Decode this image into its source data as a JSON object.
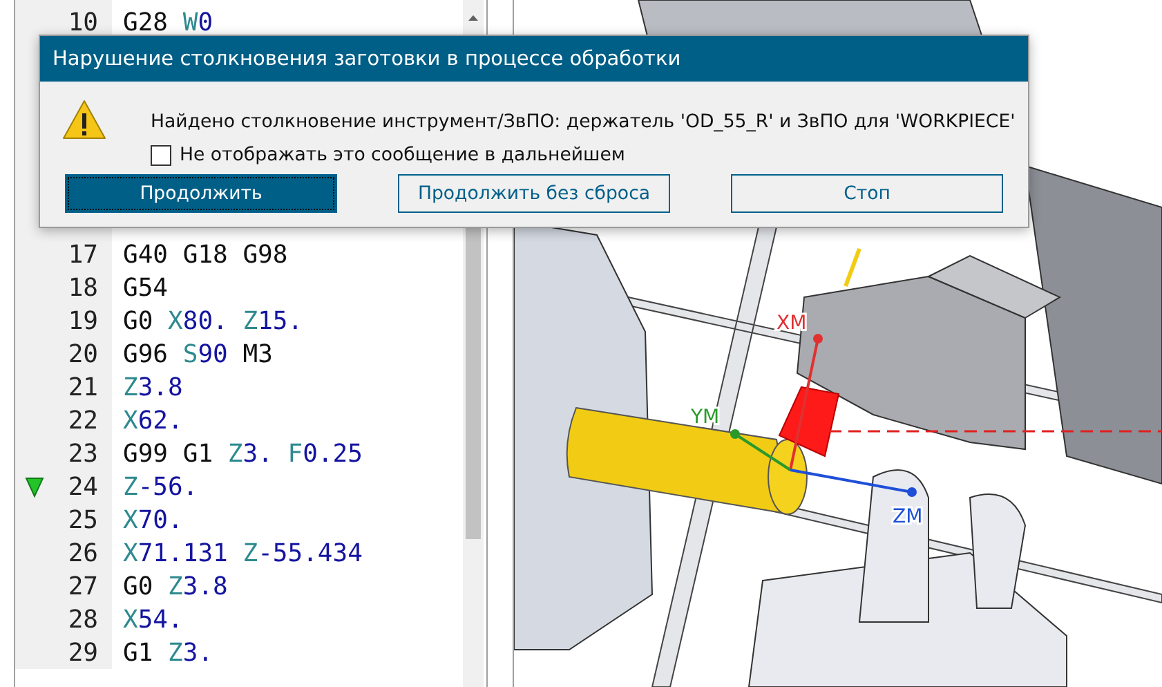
{
  "editor": {
    "lines": [
      {
        "number": "10",
        "marker": false,
        "tokens": [
          {
            "kind": "word",
            "text": "G28"
          },
          {
            "kind": "address",
            "letter": "W",
            "value": "0"
          }
        ]
      },
      {
        "number": "17",
        "marker": false,
        "tokens": [
          {
            "kind": "word",
            "text": "G40"
          },
          {
            "kind": "word",
            "text": "G18"
          },
          {
            "kind": "word",
            "text": "G98"
          }
        ]
      },
      {
        "number": "18",
        "marker": false,
        "tokens": [
          {
            "kind": "word",
            "text": "G54"
          }
        ]
      },
      {
        "number": "19",
        "marker": false,
        "tokens": [
          {
            "kind": "word",
            "text": "G0"
          },
          {
            "kind": "address",
            "letter": "X",
            "value": "80."
          },
          {
            "kind": "address",
            "letter": "Z",
            "value": "15."
          }
        ]
      },
      {
        "number": "20",
        "marker": false,
        "tokens": [
          {
            "kind": "word",
            "text": "G96"
          },
          {
            "kind": "address",
            "letter": "S",
            "value": "90"
          },
          {
            "kind": "word",
            "text": "M3"
          }
        ]
      },
      {
        "number": "21",
        "marker": false,
        "tokens": [
          {
            "kind": "address",
            "letter": "Z",
            "value": "3.8"
          }
        ]
      },
      {
        "number": "22",
        "marker": false,
        "tokens": [
          {
            "kind": "address",
            "letter": "X",
            "value": "62."
          }
        ]
      },
      {
        "number": "23",
        "marker": false,
        "tokens": [
          {
            "kind": "word",
            "text": "G99"
          },
          {
            "kind": "word",
            "text": "G1"
          },
          {
            "kind": "address",
            "letter": "Z",
            "value": "3."
          },
          {
            "kind": "address",
            "letter": "F",
            "value": "0.25"
          }
        ]
      },
      {
        "number": "24",
        "marker": true,
        "tokens": [
          {
            "kind": "address",
            "letter": "Z",
            "value": "-56."
          }
        ]
      },
      {
        "number": "25",
        "marker": false,
        "tokens": [
          {
            "kind": "address",
            "letter": "X",
            "value": "70."
          }
        ]
      },
      {
        "number": "26",
        "marker": false,
        "tokens": [
          {
            "kind": "address",
            "letter": "X",
            "value": "71.131"
          },
          {
            "kind": "address",
            "letter": "Z",
            "value": "-55.434"
          }
        ]
      },
      {
        "number": "27",
        "marker": false,
        "tokens": [
          {
            "kind": "word",
            "text": "G0"
          },
          {
            "kind": "address",
            "letter": "Z",
            "value": "3.8"
          }
        ]
      },
      {
        "number": "28",
        "marker": false,
        "tokens": [
          {
            "kind": "address",
            "letter": "X",
            "value": "54."
          }
        ]
      },
      {
        "number": "29",
        "marker": false,
        "tokens": [
          {
            "kind": "word",
            "text": "G1"
          },
          {
            "kind": "address",
            "letter": "Z",
            "value": "3."
          }
        ]
      }
    ]
  },
  "viewport": {
    "axes": [
      {
        "label": "XM",
        "color": "#e03030"
      },
      {
        "label": "YM",
        "color": "#2a9a2a"
      },
      {
        "label": "ZM",
        "color": "#1f4fd8"
      }
    ]
  },
  "dialog": {
    "title": "Нарушение столкновения заготовки в процессе обработки",
    "message": "Найдено столкновение инструмент/ЗвПО: держатель 'OD_55_R' и ЗвПО для 'WORKPIECE'",
    "checkbox": {
      "label": "Не отображать это сообщение в дальнейшем",
      "checked": false
    },
    "buttons": [
      {
        "label": "Продолжить",
        "default": true
      },
      {
        "label": "Продолжить без сброса",
        "default": false
      },
      {
        "label": "Стоп",
        "default": false
      }
    ]
  }
}
